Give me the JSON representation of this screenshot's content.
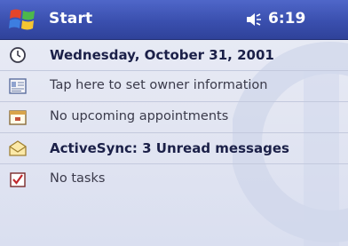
{
  "nav": {
    "title": "Start",
    "time": "6:19",
    "icons": {
      "start": "windows-flag-icon",
      "volume": "speaker-icon"
    }
  },
  "today": {
    "items": [
      {
        "icon": "clock-icon",
        "text": "Wednesday, October 31, 2001",
        "bold": true
      },
      {
        "icon": "owner-card-icon",
        "text": "Tap here to set owner information",
        "bold": false
      },
      {
        "icon": "calendar-icon",
        "text": "No upcoming appointments",
        "bold": false
      },
      {
        "icon": "inbox-envelope-icon",
        "text": "ActiveSync: 3 Unread messages",
        "bold": true
      },
      {
        "icon": "tasks-checkbox-icon",
        "text": "No tasks",
        "bold": false
      }
    ]
  },
  "colors": {
    "nav_bar": "#3a4fae",
    "background": "#e3e6f2",
    "bold_text": "#1b2048"
  }
}
